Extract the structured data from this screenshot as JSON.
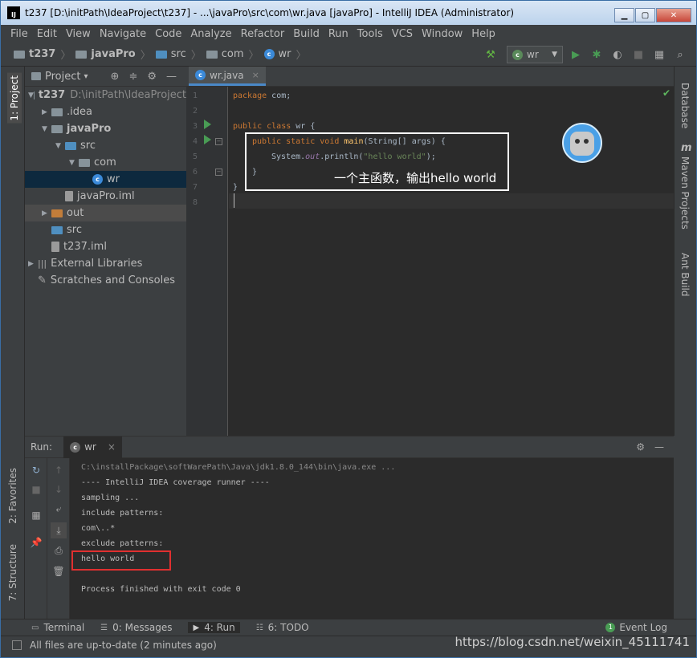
{
  "window": {
    "title": "t237 [D:\\initPath\\IdeaProject\\t237] - ...\\javaPro\\src\\com\\wr.java [javaPro] - IntelliJ IDEA (Administrator)",
    "app_icon": "IJ",
    "controls": [
      "minimize",
      "maximize",
      "close"
    ]
  },
  "menu": [
    "File",
    "Edit",
    "View",
    "Navigate",
    "Code",
    "Analyze",
    "Refactor",
    "Build",
    "Run",
    "Tools",
    "VCS",
    "Window",
    "Help"
  ],
  "breadcrumb": [
    "t237",
    "javaPro",
    "src",
    "com",
    "wr"
  ],
  "toolbar": {
    "run_config": "wr",
    "run_config_arrow": "▼",
    "icons": [
      "build-hammer-icon",
      "run-icon",
      "debug-icon",
      "run-coverage-icon",
      "stop-icon",
      "project-structure-icon",
      "search-everywhere-icon"
    ]
  },
  "left_strip": {
    "project_tab": "1: Project",
    "favorites_tab": "2: Favorites",
    "structure_tab": "7: Structure"
  },
  "right_strip": {
    "database_tab": "Database",
    "maven_tab": "Maven Projects",
    "ant_tab": "Ant Build",
    "maven_m": "m"
  },
  "project_panel": {
    "header": "Project",
    "dropdown": "▾",
    "tree": [
      {
        "label": "t237",
        "extra": "D:\\initPath\\IdeaProject",
        "depth": 0,
        "arrow": "▼",
        "icon": "folder",
        "bold": true
      },
      {
        "label": ".idea",
        "depth": 1,
        "arrow": "▶",
        "icon": "folder"
      },
      {
        "label": "javaPro",
        "depth": 1,
        "arrow": "▼",
        "icon": "folder",
        "bold": true
      },
      {
        "label": "src",
        "depth": 2,
        "arrow": "▼",
        "icon": "folder-blue"
      },
      {
        "label": "com",
        "depth": 3,
        "arrow": "▼",
        "icon": "package"
      },
      {
        "label": "wr",
        "depth": 4,
        "arrow": "",
        "icon": "class",
        "selected": true
      },
      {
        "label": "javaPro.iml",
        "depth": 2,
        "arrow": "",
        "icon": "file"
      },
      {
        "label": "out",
        "depth": 1,
        "arrow": "▶",
        "icon": "folder-orange",
        "highlight": true
      },
      {
        "label": "src",
        "depth": 1,
        "arrow": "",
        "icon": "folder-blue"
      },
      {
        "label": "t237.iml",
        "depth": 1,
        "arrow": "",
        "icon": "file"
      },
      {
        "label": "External Libraries",
        "depth": 0,
        "arrow": "▶",
        "icon": "library"
      },
      {
        "label": "Scratches and Consoles",
        "depth": 0,
        "arrow": "",
        "icon": "scratches"
      }
    ]
  },
  "editor": {
    "tab_label": "wr.java",
    "tab_close": "×",
    "line_numbers": [
      "1",
      "2",
      "3",
      "4",
      "5",
      "6",
      "7",
      "8"
    ],
    "code": {
      "l1_kw": "package",
      "l1_rest": " com;",
      "l3_kw": "public class",
      "l3_rest": " wr {",
      "l4_kw": "public static void",
      "l4_fn": " main",
      "l4_rest": "(String[] args) {",
      "l5_a": "System.",
      "l5_fld": "out",
      "l5_b": ".println(",
      "l5_str": "\"hello world\"",
      "l5_c": ");",
      "l6": "}",
      "l7": "}"
    },
    "annotation": "一个主函数，输出hello world"
  },
  "run_panel": {
    "label": "Run:",
    "tab": "wr",
    "tab_close": "×",
    "console": [
      {
        "text": "C:\\installPackage\\softWarePath\\Java\\jdk1.8.0_144\\bin\\java.exe ...",
        "dim": true
      },
      {
        "text": "---- IntelliJ IDEA coverage runner ----"
      },
      {
        "text": "sampling ..."
      },
      {
        "text": "include patterns:"
      },
      {
        "text": "com\\..*"
      },
      {
        "text": "exclude patterns:"
      },
      {
        "text": "hello world"
      },
      {
        "text": ""
      },
      {
        "text": "Process finished with exit code 0"
      }
    ]
  },
  "bottom_tabs": [
    {
      "label": "Terminal",
      "icon": "terminal-icon"
    },
    {
      "label": "0: Messages",
      "icon": "messages-icon"
    },
    {
      "label": "4: Run",
      "icon": "run-icon",
      "active": true
    },
    {
      "label": "6: TODO",
      "icon": "todo-icon"
    }
  ],
  "event_log": {
    "label": "Event Log",
    "count": "1"
  },
  "status": {
    "text": "All files are up-to-date (2 minutes ago)"
  },
  "watermark": "https://blog.csdn.net/weixin_45111741"
}
